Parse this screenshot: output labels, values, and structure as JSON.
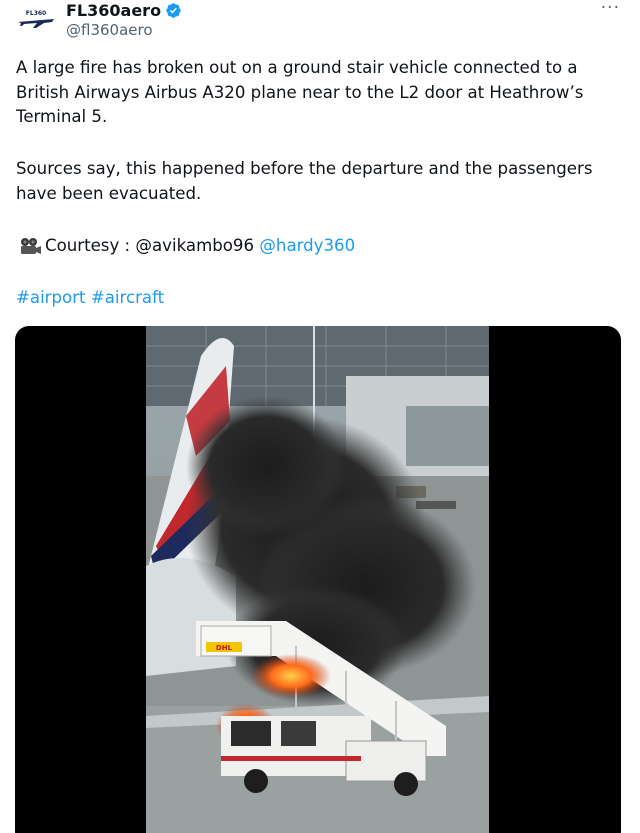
{
  "author": {
    "display_name": "FL360aero",
    "handle": "@fl360aero",
    "avatar_text": "FL360",
    "verified": true
  },
  "menu": {
    "more_label": "···"
  },
  "tweet": {
    "paragraph1": "A large fire has broken out on a ground stair vehicle connected to a British Airways Airbus A320 plane near to the L2 door at Heathrow’s Terminal 5.",
    "paragraph2": "Sources say, this happened before the departure and the passengers have been evacuated.",
    "courtesy_prefix": "Courtesy : @avikambo96 ",
    "courtesy_link": "@hardy360",
    "hashtags": [
      "#airport",
      "#aircraft"
    ]
  },
  "media": {
    "stair_truck_brand": "DHL",
    "icon": "camera-icon"
  },
  "colors": {
    "link": "#1d9bf0",
    "text": "#0f1419",
    "secondary": "#536471",
    "verified": "#1d9bf0"
  }
}
